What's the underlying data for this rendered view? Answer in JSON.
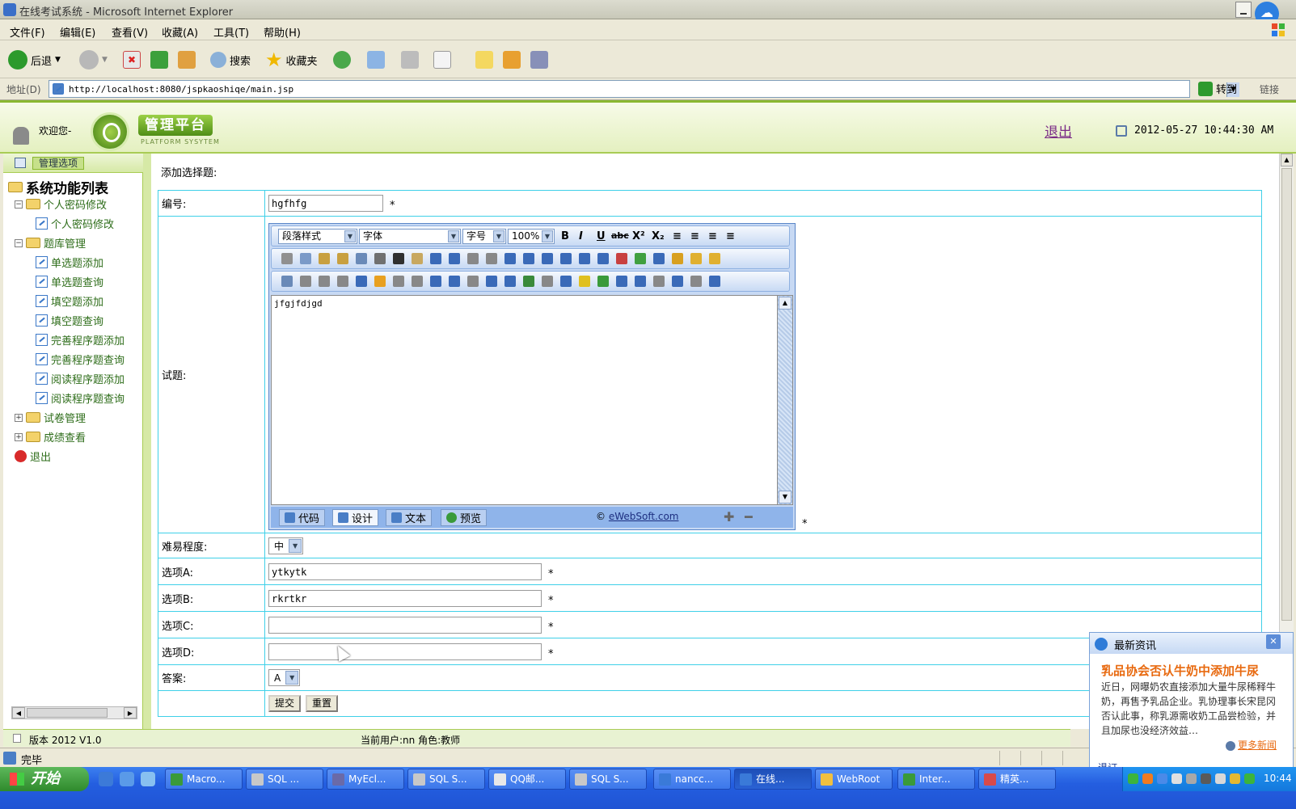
{
  "window": {
    "title": "在线考试系统 - Microsoft Internet Explorer"
  },
  "menubar": {
    "items": [
      "文件(F)",
      "编辑(E)",
      "查看(V)",
      "收藏(A)",
      "工具(T)",
      "帮助(H)"
    ]
  },
  "toolbar": {
    "back": "后退",
    "search": "搜索",
    "favorites": "收藏夹"
  },
  "address": {
    "label": "地址(D)",
    "url": "http://localhost:8080/jspkaoshiqe/main.jsp",
    "go": "转到",
    "links": "链接"
  },
  "header": {
    "welcome": "欢迎您-",
    "platform": "管理平台",
    "platform_sub": "PLATFORM SYSYTEM",
    "logout": "退出",
    "datetime": "2012-05-27 10:44:30 AM"
  },
  "sidebar": {
    "header": "管理选项",
    "root": "系统功能列表",
    "items": [
      {
        "label": "个人密码修改",
        "level": 1,
        "type": "folder"
      },
      {
        "label": "个人密码修改",
        "level": 2,
        "type": "page"
      },
      {
        "label": "题库管理",
        "level": 1,
        "type": "folder"
      },
      {
        "label": "单选题添加",
        "level": 2,
        "type": "page"
      },
      {
        "label": "单选题查询",
        "level": 2,
        "type": "page"
      },
      {
        "label": "填空题添加",
        "level": 2,
        "type": "page"
      },
      {
        "label": "填空题查询",
        "level": 2,
        "type": "page"
      },
      {
        "label": "完善程序题添加",
        "level": 2,
        "type": "page"
      },
      {
        "label": "完善程序题查询",
        "level": 2,
        "type": "page"
      },
      {
        "label": "阅读程序题添加",
        "level": 2,
        "type": "page"
      },
      {
        "label": "阅读程序题查询",
        "level": 2,
        "type": "page"
      },
      {
        "label": "试卷管理",
        "level": 1,
        "type": "folder"
      },
      {
        "label": "成绩查看",
        "level": 1,
        "type": "folder"
      },
      {
        "label": "退出",
        "level": 1,
        "type": "exit"
      }
    ]
  },
  "form": {
    "section_title": "添加选择题:",
    "fields": {
      "id_label": "编号:",
      "id_value": "hgfhfg",
      "question_label": "试题:",
      "difficulty_label": "难易程度:",
      "difficulty_value": "中",
      "option_a_label": "选项A:",
      "option_a_value": "ytkytk",
      "option_b_label": "选项B:",
      "option_b_value": "rkrtkr",
      "option_c_label": "选项C:",
      "option_c_value": "",
      "option_d_label": "选项D:",
      "option_d_value": "",
      "answer_label": "答案:",
      "answer_value": "A"
    },
    "required_mark": "*",
    "submit": "提交",
    "reset": "重置"
  },
  "editor": {
    "paragraph_style": "段落样式",
    "font": "字体",
    "font_size": "字号",
    "zoom": "100%",
    "content": "jfgjfdjgd",
    "tabs": [
      "代码",
      "设计",
      "文本",
      "预览"
    ],
    "active_tab": "设计",
    "copyright_prefix": "© ",
    "copyright_link": "eWebSoft.com"
  },
  "footer": {
    "version": "版本 2012 V1.0",
    "current_user": "当前用户:nn    角色:教师"
  },
  "statusbar": {
    "text": "完毕"
  },
  "news": {
    "title": "最新资讯",
    "headline": "乳品协会否认牛奶中添加牛尿",
    "body": "近日，网曝奶农直接添加大量牛尿稀释牛奶，再售予乳品企业。乳协理事长宋昆冈否认此事，称乳源需收奶工品尝检验，并且加尿也没经济效益…",
    "more": "更多新闻",
    "back": "退订"
  },
  "taskbar": {
    "start": "开始",
    "tasks": [
      "Macro...",
      "SQL ...",
      "MyEcl...",
      "SQL S...",
      "QQ邮...",
      "SQL S...",
      "nancc...",
      "在线...",
      "WebRoot",
      "Inter...",
      "精英..."
    ],
    "active_task": "在线...",
    "clock": "10:44"
  }
}
